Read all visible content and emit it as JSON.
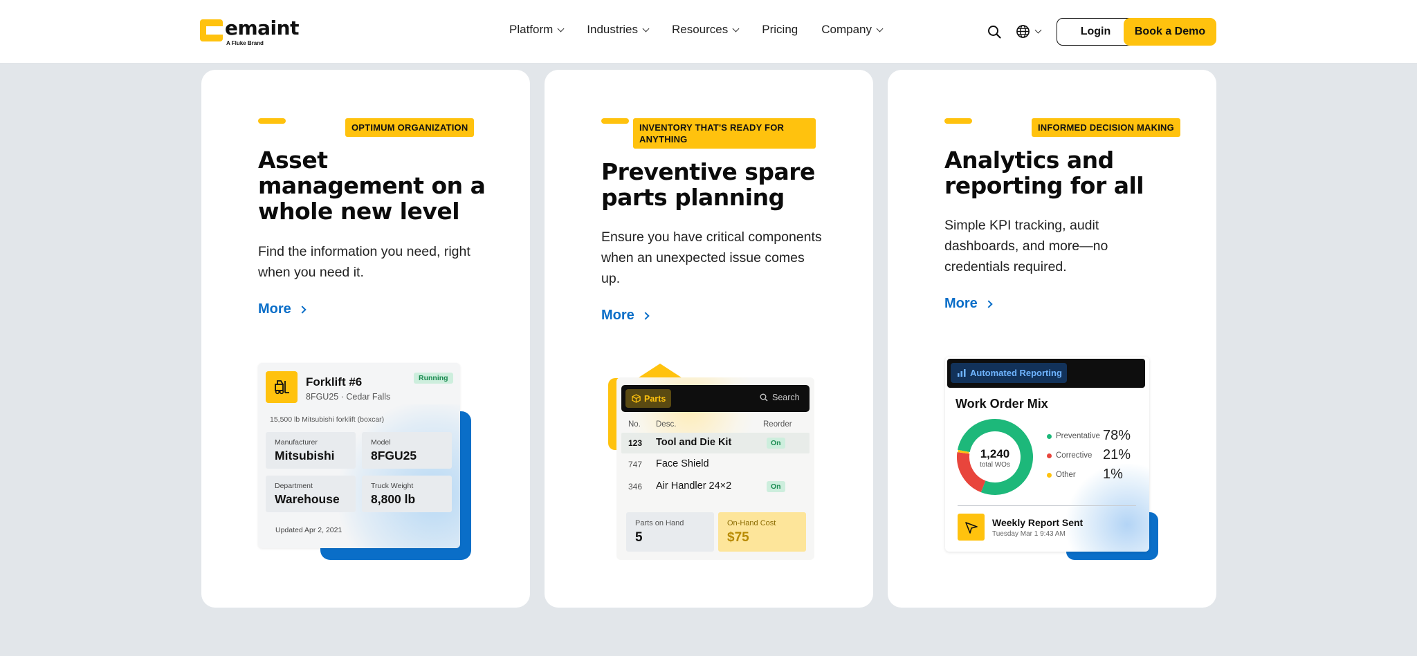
{
  "header": {
    "logo_word": "emaint",
    "logo_sub": "A Fluke Brand",
    "nav": [
      {
        "label": "Platform",
        "has_menu": true
      },
      {
        "label": "Industries",
        "has_menu": true
      },
      {
        "label": "Resources",
        "has_menu": true
      },
      {
        "label": "Pricing",
        "has_menu": false
      },
      {
        "label": "Company",
        "has_menu": true
      }
    ],
    "login_label": "Login",
    "demo_label": "Book a Demo"
  },
  "cards": [
    {
      "eyebrow": "OPTIMUM ORGANIZATION",
      "title": "Asset management on a whole new level",
      "desc": "Find the information you need, right when you need it.",
      "more": "More",
      "mock": {
        "name": "Forklift #6",
        "sub": "8FGU25 · Cedar Falls",
        "badge": "Running",
        "line": "15,500 lb Mitsubishi forklift (boxcar)",
        "fields": [
          {
            "label": "Manufacturer",
            "value": "Mitsubishi"
          },
          {
            "label": "Model",
            "value": "8FGU25"
          },
          {
            "label": "Department",
            "value": "Warehouse"
          },
          {
            "label": "Truck Weight",
            "value": "8,800 lb"
          }
        ],
        "updated": "Updated Apr 2, 2021"
      }
    },
    {
      "eyebrow": "INVENTORY THAT'S READY FOR ANYTHING",
      "title": "Preventive spare parts planning",
      "desc": "Ensure you have critical components when an unexpected issue comes up.",
      "more": "More",
      "mock": {
        "tab": "Parts",
        "search": "Search",
        "headers": {
          "no": "No.",
          "desc": "Desc.",
          "reorder": "Reorder"
        },
        "rows": [
          {
            "no": "123",
            "desc": "Tool and Die Kit",
            "reorder": "On"
          },
          {
            "no": "747",
            "desc": "Face Shield",
            "reorder": ""
          },
          {
            "no": "346",
            "desc": "Air Handler 24×2",
            "reorder": "On"
          }
        ],
        "stat1": {
          "label": "Parts on Hand",
          "value": "5"
        },
        "stat2": {
          "label": "On-Hand Cost",
          "value": "$75"
        }
      }
    },
    {
      "eyebrow": "INFORMED DECISION MAKING",
      "title": "Analytics and reporting for all",
      "desc": "Simple KPI tracking, audit dashboards, and more—no credentials required.",
      "more": "More",
      "mock": {
        "tab": "Automated Reporting",
        "title": "Work Order Mix",
        "total": "1,240",
        "total_label": "total WOs",
        "legend": [
          {
            "label": "Preventative",
            "pct": "78%",
            "value": 78,
            "color": "#1db87a"
          },
          {
            "label": "Corrective",
            "pct": "21%",
            "value": 21,
            "color": "#e8453c"
          },
          {
            "label": "Other",
            "pct": "1%",
            "value": 1,
            "color": "#ffc20e"
          }
        ],
        "report_title": "Weekly Report Sent",
        "report_date": "Tuesday Mar 1 9:43 AM"
      }
    }
  ],
  "colors": {
    "accent": "#ffc20e",
    "link": "#0a6ec8",
    "bg": "#e2e6ea"
  }
}
